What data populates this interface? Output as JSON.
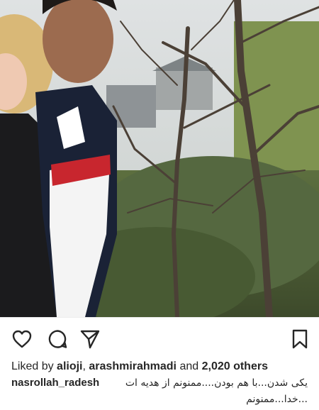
{
  "post": {
    "photo_icon": "photo-of-two-people-in-garden",
    "actions": {
      "like_icon": "heart-icon",
      "comment_icon": "comment-bubble-icon",
      "share_icon": "paper-plane-icon",
      "save_icon": "bookmark-icon"
    },
    "likes": {
      "prefix": "Liked by ",
      "user1": "alioji",
      "separator": ", ",
      "user2": "arashmirahmadi",
      "middle": " and ",
      "count": "2,020 others"
    },
    "caption": {
      "username": "nasrollah_radesh",
      "line1": "یکی شدن...با هم بودن....ممنونم از هدیه ات",
      "line2": "...خدا...ممنونم"
    }
  },
  "colors": {
    "text": "#262626",
    "divider": "#eeeeee"
  }
}
